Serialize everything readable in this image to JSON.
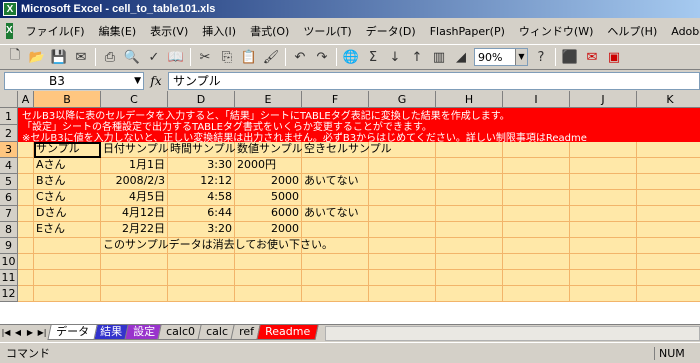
{
  "window": {
    "title": "Microsoft Excel - cell_to_table101.xls",
    "app_icon": "X"
  },
  "menu": [
    "ファイル(F)",
    "編集(E)",
    "表示(V)",
    "挿入(I)",
    "書式(O)",
    "ツール(T)",
    "データ(D)",
    "FlashPaper(P)",
    "ウィンドウ(W)",
    "ヘルプ(H)",
    "Adobe"
  ],
  "toolbar": {
    "zoom": "90%"
  },
  "formula_bar": {
    "name_box": "B3",
    "fx": "fx",
    "content": "サンプル"
  },
  "columns": [
    "A",
    "B",
    "C",
    "D",
    "E",
    "F",
    "G",
    "H",
    "I",
    "J",
    "K"
  ],
  "rows": [
    "1",
    "2",
    "3",
    "4",
    "5",
    "6",
    "7",
    "8",
    "9",
    "10",
    "11",
    "12"
  ],
  "banner": [
    "セルB3以降に表のセルデータを入力すると、「結果」シートにTABLEタグ表記に変換した結果を作成します。",
    "「設定」シートの各種設定で出力するTABLEタグ書式をいくらか変更することができます。",
    "※セルB3に値を入力しないと、正しい変換結果は出力されません。必ずB3からはじめてください。詳しい制限事項はReadme"
  ],
  "table": {
    "header": [
      "サンプル",
      "日付サンプル",
      "時間サンプル",
      "数値サンプル",
      "空きセルサンプル"
    ],
    "rows": [
      [
        "Aさん",
        "1月1日",
        "3:30",
        "2000円",
        ""
      ],
      [
        "Bさん",
        "2008/2/3",
        "12:12",
        "2000",
        "あいてない"
      ],
      [
        "Cさん",
        "4月5日",
        "4:58",
        "5000",
        ""
      ],
      [
        "Dさん",
        "4月12日",
        "6:44",
        "6000",
        "あいてない"
      ],
      [
        "Eさん",
        "2月22日",
        "3:20",
        "2000",
        ""
      ]
    ],
    "note": "このサンプルデータは消去してお使い下さい。"
  },
  "sheet_tabs": [
    "データ",
    "結果",
    "設定",
    "calc0",
    "calc",
    "ref",
    "Readme"
  ],
  "status": {
    "mode": "コマンド",
    "num": "NUM"
  },
  "colors": {
    "banner": "#ff0000",
    "cell_fill": "#ffe8a8",
    "tab_result": "#3333cc",
    "tab_settings": "#9933cc",
    "tab_readme": "#ff0000"
  }
}
